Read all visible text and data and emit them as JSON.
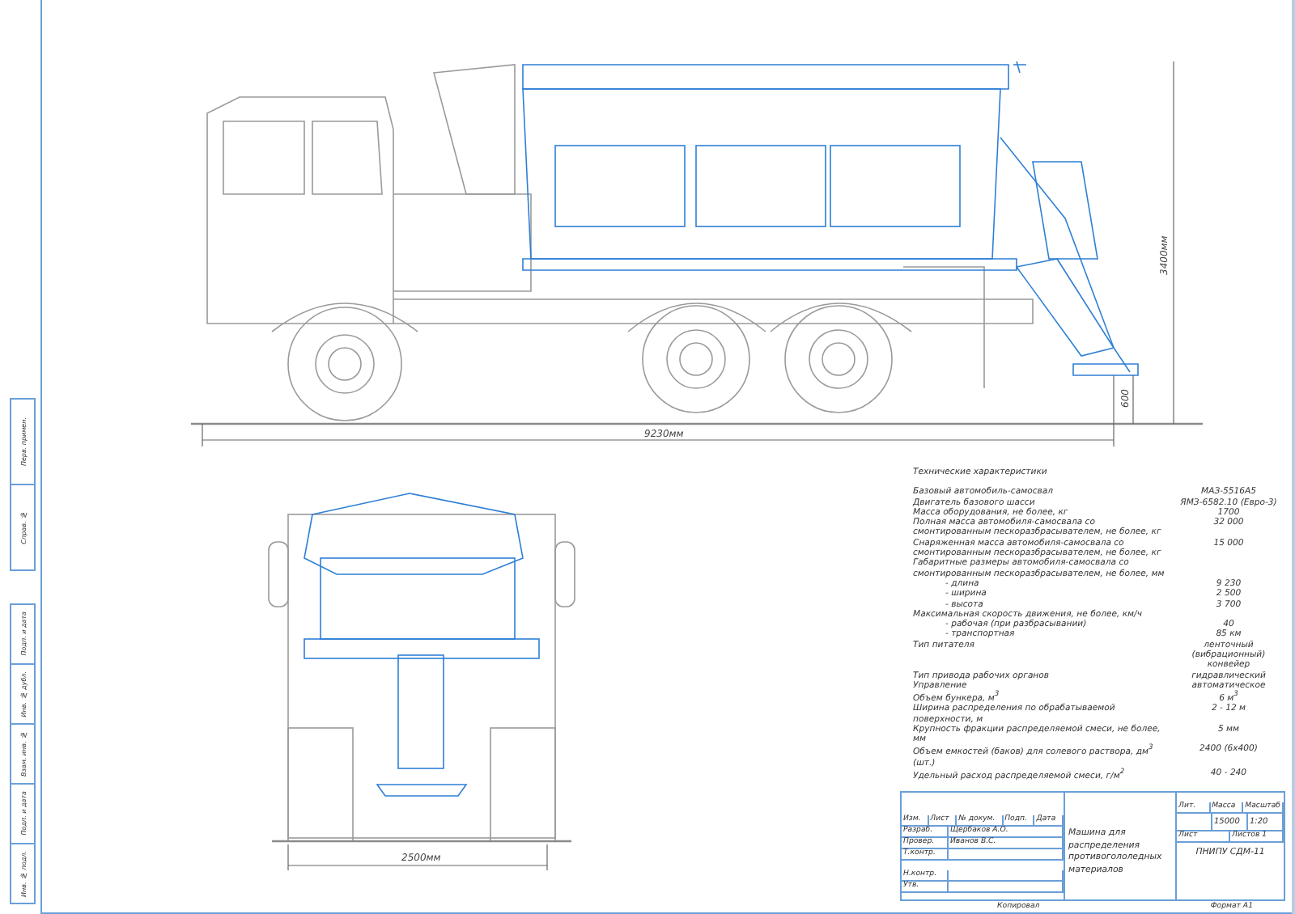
{
  "side_view": {
    "length_dim": "9230мм",
    "height_dim": "3400мм",
    "clearance_dim": "600"
  },
  "front_view": {
    "width_dim": "2500мм"
  },
  "margin_labels": [
    "Перв. примен.",
    "Справ. №",
    "Подп. и дата",
    "Инв. № дубл.",
    "Взам. инв. №",
    "Подп. и дата",
    "Инв. № подл."
  ],
  "specs": {
    "title": "Технические характеристики",
    "rows": [
      {
        "kind": "main",
        "label": "Базовый автомобиль-самосвал",
        "value": "МАЗ-5516А5"
      },
      {
        "kind": "main",
        "label": "Двигатель базового шасси",
        "value": "ЯМЗ-6582.10 (Евро-3)"
      },
      {
        "kind": "main",
        "label": "Масса оборудования, не более, кг",
        "value": "1700"
      },
      {
        "kind": "main",
        "label": "Полная масса автомобиля-самосвала со смонтированным пескоразбрасывателем, не более, кг",
        "value": "32 000"
      },
      {
        "kind": "main",
        "label": "Снаряженная масса автомобиля-самосвала со смонтированным пескоразбрасывателем, не более, кг",
        "value": "15 000"
      },
      {
        "kind": "main",
        "label": "Габаритные размеры автомобиля-самосвала со смонтированным пескоразбрасывателем, не более, мм"
      },
      {
        "kind": "sub",
        "label": "- длина",
        "value": "9 230"
      },
      {
        "kind": "sub",
        "label": "- ширина",
        "value": "2 500"
      },
      {
        "kind": "sub",
        "label": "- высота",
        "value": "3 700"
      },
      {
        "kind": "main",
        "label": "Максимальная скорость движения, не более, км/ч"
      },
      {
        "kind": "sub",
        "label": "- рабочая (при разбрасывании)",
        "value": "40"
      },
      {
        "kind": "sub",
        "label": "- транспортная",
        "value": "85 км"
      },
      {
        "kind": "main",
        "label": "Тип питателя",
        "value": "ленточный (вибрационный) конвейер"
      },
      {
        "kind": "main",
        "label": "Тип привода рабочих органов",
        "value": "гидравлический"
      },
      {
        "kind": "main",
        "label": "Управление",
        "value": "автоматическое"
      },
      {
        "kind": "main",
        "label": "Объем бункера, м$^{3}$",
        "value": "6 м$^{3}$"
      },
      {
        "kind": "main",
        "label": "Ширина распределения по обрабатываемой поверхности, м",
        "value": "2 - 12 м"
      },
      {
        "kind": "main",
        "label": "Крупность фракции распределяемой смеси, не более, мм",
        "value": "5 мм"
      },
      {
        "kind": "main",
        "label": "Объем емкостей (баков) для солевого раствора, дм$^{3}$ (шт.)",
        "value": "2400 (6х400)"
      },
      {
        "kind": "main",
        "label": "Удельный расход распределяемой смеси, г/м$^{2}$",
        "value": "40 - 240"
      }
    ]
  },
  "title_block": {
    "revision_headers": [
      "Изм.",
      "Лист",
      "№ докум.",
      "Подп.",
      "Дата"
    ],
    "roles": [
      "Разраб.",
      "Провер.",
      "Т.контр.",
      "Н.контр.",
      "Утв."
    ],
    "names": [
      "Щербаков А.О.",
      "Иванов В.С."
    ],
    "drawing_title": "Машина для распределения противогололедных материалов",
    "header_cells": [
      "Лит.",
      "Масса",
      "Масштаб"
    ],
    "mass": "15000",
    "scale": "1:20",
    "sheet_label": "Лист",
    "sheets_label": "Листов 1",
    "designation": "ПНИПУ СДМ-11",
    "copied": "Копировал",
    "format": "Формат А1"
  }
}
